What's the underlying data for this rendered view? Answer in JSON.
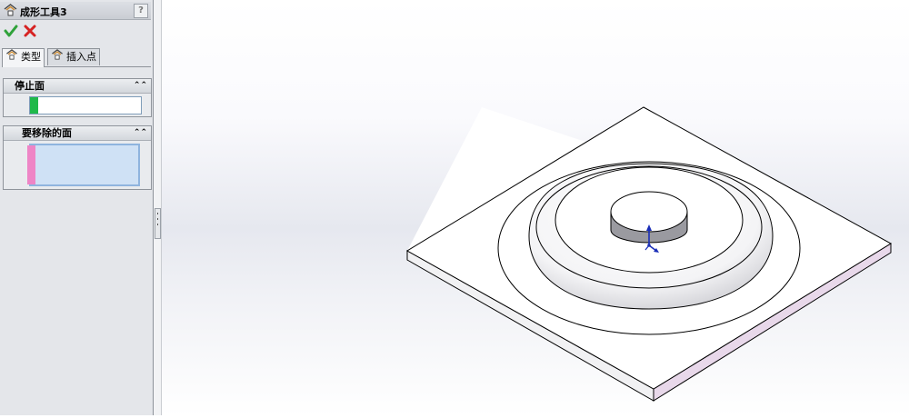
{
  "panel": {
    "title": "成形工具3",
    "help": "?",
    "ok_icon": "checkmark-icon",
    "cancel_icon": "x-icon",
    "tabs": [
      {
        "label": "类型",
        "icon": "forming-tool-icon",
        "active": true
      },
      {
        "label": "插入点",
        "icon": "forming-tool-icon",
        "active": false
      }
    ],
    "groups": [
      {
        "title": "停止面",
        "marker_color": "#1fb94a"
      },
      {
        "title": "要移除的面",
        "marker_color": "#ee85c6"
      }
    ],
    "collapse_glyph": "⌃⌃"
  },
  "colors": {
    "selection_fill": "#cfe1f5",
    "selection_border": "#8fb4de",
    "stop_face_marker": "#1fb94a",
    "remove_face_marker": "#ee85c6",
    "triad_color": "#1a2eb8"
  }
}
